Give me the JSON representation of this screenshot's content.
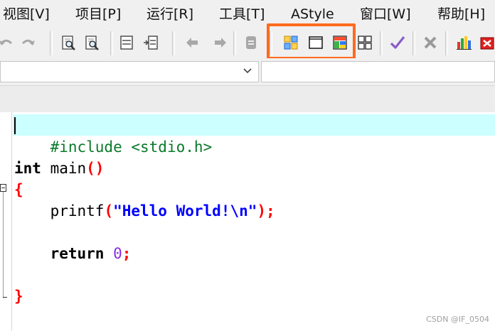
{
  "menu": {
    "items": [
      "视图[V]",
      "项目[P]",
      "运行[R]",
      "工具[T]",
      "AStyle",
      "窗口[W]",
      "帮助[H]"
    ]
  },
  "toolbar": {
    "icons": [
      "undo-icon",
      "redo-icon",
      "find-icon",
      "find-next-icon",
      "window-icon",
      "panel-icon",
      "back-icon",
      "forward-icon",
      "compile-icon",
      "tile-layout-icon",
      "full-screen-icon",
      "color-layout-icon",
      "grid-layout-icon",
      "check-icon",
      "close-icon",
      "chart-icon",
      "stop-icon"
    ],
    "highlight_color": "#ff6a1f"
  },
  "editor": {
    "current_line_color": "#ccffff",
    "lines": {
      "include": "#include <stdio.h>",
      "main_kw": "int",
      "main_rest": " main",
      "main_paren": "()",
      "open_brace": "{",
      "printf_fn": "    printf",
      "printf_open": "(",
      "printf_str": "\"Hello World!\\n\"",
      "printf_close": ")",
      "printf_semi": ";",
      "return_kw": "    return",
      "return_num": "0",
      "return_semi": ";",
      "close_brace": "}"
    }
  },
  "watermark": "CSDN @IF_0504"
}
